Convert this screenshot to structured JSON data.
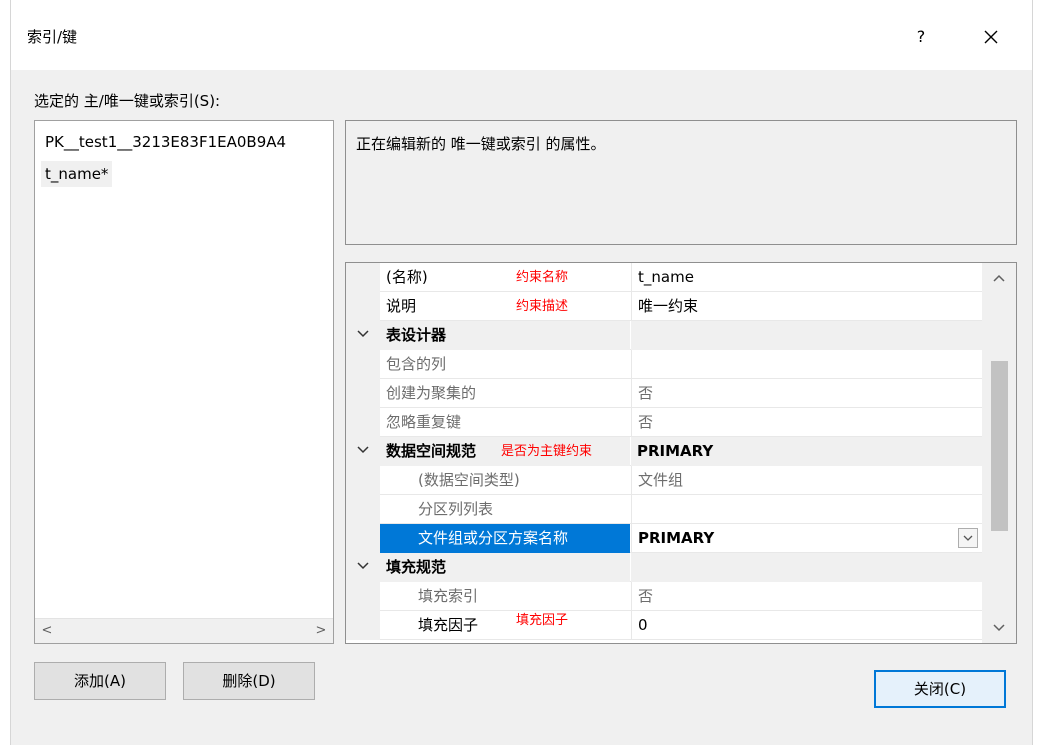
{
  "window": {
    "title": "索引/键",
    "help_glyph": "?"
  },
  "left_panel": {
    "label": "选定的 主/唯一键或索引(S):",
    "items": [
      "PK__test1__3213E83F1EA0B9A4",
      "t_name*"
    ],
    "scroll_left": "<",
    "scroll_right": ">"
  },
  "description": "正在编辑新的 唯一键或索引 的属性。",
  "properties": [
    {
      "name": "(名称)",
      "value": "t_name",
      "annotation": "约束名称",
      "style": "normal"
    },
    {
      "name": "说明",
      "value": "唯一约束",
      "annotation": "约束描述",
      "style": "normal"
    },
    {
      "name": "表设计器",
      "value": "",
      "annotation": "",
      "style": "category"
    },
    {
      "name": "包含的列",
      "value": "",
      "annotation": "",
      "style": "gray"
    },
    {
      "name": "创建为聚集的",
      "value": "否",
      "annotation": "",
      "style": "gray"
    },
    {
      "name": "忽略重复键",
      "value": "否",
      "annotation": "",
      "style": "gray"
    },
    {
      "name": "数据空间规范",
      "value": "PRIMARY",
      "annotation": "是否为主键约束",
      "style": "category"
    },
    {
      "name": "(数据空间类型)",
      "value": "文件组",
      "annotation": "",
      "style": "gray-indent"
    },
    {
      "name": "分区列列表",
      "value": "",
      "annotation": "",
      "style": "gray-indent"
    },
    {
      "name": "文件组或分区方案名称",
      "value": "PRIMARY",
      "annotation": "",
      "style": "selected"
    },
    {
      "name": "填充规范",
      "value": "",
      "annotation": "",
      "style": "category"
    },
    {
      "name": "填充索引",
      "value": "否",
      "annotation": "",
      "style": "gray-indent"
    },
    {
      "name": "填充因子",
      "value": "0",
      "annotation": "填充因子",
      "style": "indent"
    }
  ],
  "buttons": {
    "add": "添加(A)",
    "delete": "删除(D)",
    "close": "关闭(C)"
  },
  "colors": {
    "selection": "#0078d7",
    "annotation": "#ff0000",
    "dialog_bg": "#f0f0f0"
  }
}
